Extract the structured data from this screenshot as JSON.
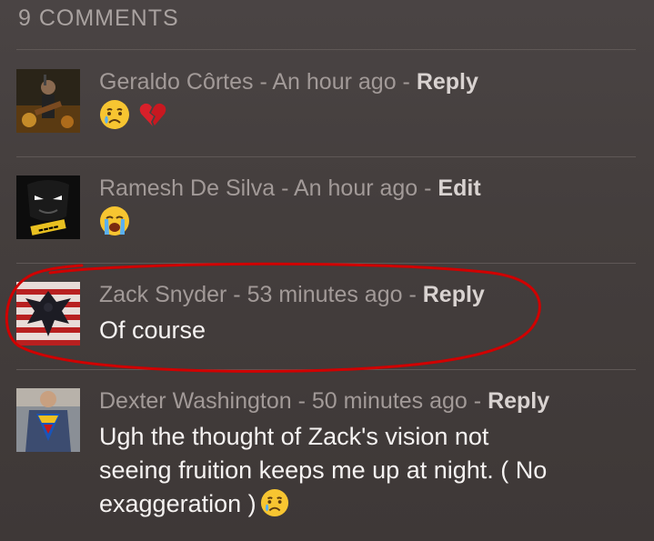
{
  "header": {
    "title": "9 COMMENTS"
  },
  "comments": [
    {
      "author": "Geraldo Côrtes",
      "time": "An hour ago",
      "action": "Reply",
      "emoji": [
        "crying-face",
        "broken-heart"
      ]
    },
    {
      "author": "Ramesh De Silva",
      "time": "An hour ago",
      "action": "Edit",
      "emoji": [
        "loudly-crying-face"
      ]
    },
    {
      "author": "Zack Snyder",
      "time": "53 minutes ago",
      "action": "Reply",
      "text": "Of course"
    },
    {
      "author": "Dexter Washington",
      "time": "50 minutes ago",
      "action": "Reply",
      "text_line1": "Ugh the thought of Zack's vision not",
      "text_line2": "seeing fruition keeps me up at night. ( No",
      "text_line3": "exaggeration )",
      "emoji": [
        "crying-face"
      ]
    }
  ],
  "separator": " - ",
  "colors": {
    "background": "#463f3e",
    "meta_text": "#a29a98",
    "action_text": "#d9d3d1",
    "body_text": "#f5f2f1",
    "highlight_circle": "#d00000"
  }
}
